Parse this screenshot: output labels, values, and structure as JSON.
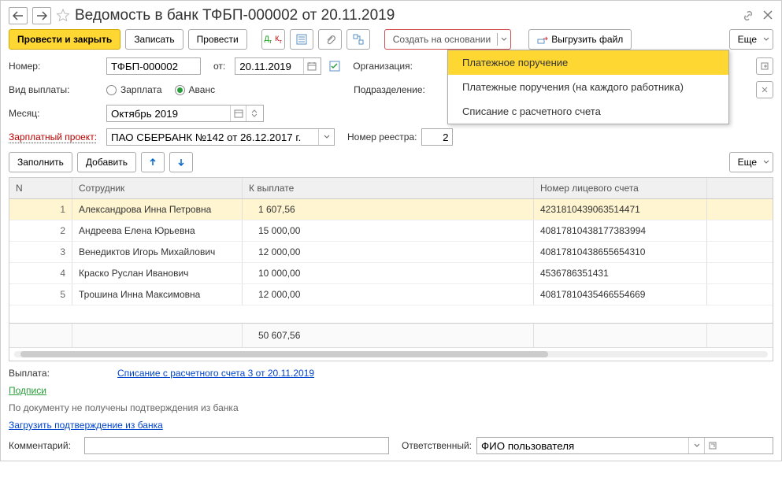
{
  "title": "Ведомость в банк ТФБП-000002 от 20.11.2019",
  "toolbar": {
    "complete": "Провести и закрыть",
    "save": "Записать",
    "post": "Провести",
    "create_based": "Создать на основании",
    "upload": "Выгрузить файл",
    "more": "Еще"
  },
  "dropdown": {
    "item1": "Платежное поручение",
    "item2": "Платежные поручения (на каждого работника)",
    "item3": "Списание с расчетного счета"
  },
  "fields": {
    "number_lbl": "Номер:",
    "number_val": "ТФБП-000002",
    "date_lbl": "от:",
    "date_val": "20.11.2019",
    "org_lbl": "Организация:",
    "paytype_lbl": "Вид выплаты:",
    "salary_opt": "Зарплата",
    "advance_opt": "Аванс",
    "dept_lbl": "Подразделение:",
    "month_lbl": "Месяц:",
    "month_val": "Октябрь 2019",
    "project_lbl": "Зарплатный проект:",
    "project_val": "ПАО СБЕРБАНК №142 от 26.12.2017 г.",
    "registry_lbl": "Номер реестра:",
    "registry_val": "2",
    "fill": "Заполнить",
    "add": "Добавить"
  },
  "table": {
    "h_n": "N",
    "h_emp": "Сотрудник",
    "h_pay": "К выплате",
    "h_acc": "Номер лицевого счета",
    "total": "50 607,56",
    "rows": [
      {
        "n": "1",
        "emp": "Александрова Инна Петровна",
        "pay": "1 607,56",
        "acc": "4231810439063514471"
      },
      {
        "n": "2",
        "emp": "Андреева Елена Юрьевна",
        "pay": "15 000,00",
        "acc": "4081781043817738З994"
      },
      {
        "n": "3",
        "emp": "Венедиктов Игорь Михайлович",
        "pay": "12 000,00",
        "acc": "40817810438655654310"
      },
      {
        "n": "4",
        "emp": "Краско Руслан Иванович",
        "pay": "10 000,00",
        "acc": "4536786351431"
      },
      {
        "n": "5",
        "emp": "Трошина Инна Максимовна",
        "pay": "12 000,00",
        "acc": "40817810435466554669"
      }
    ]
  },
  "info": {
    "pay_lbl": "Выплата:",
    "pay_link": "Списание с расчетного счета 3 от 20.11.2019",
    "sign": "Подписи",
    "noconf": "По документу не получены подтверждения из банка",
    "loadconf": "Загрузить подтверждение из банка",
    "comment_lbl": "Комментарий:",
    "resp_lbl": "Ответственный:",
    "resp_val": "ФИО пользователя"
  }
}
